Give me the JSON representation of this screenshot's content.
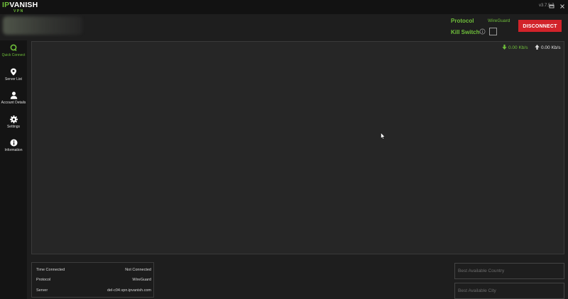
{
  "titlebar": {
    "logo_ip": "IP",
    "logo_vanish": "VANISH",
    "logo_sub": "VPN",
    "version": "v3.7.5.7",
    "minimize_icon": "minimize-icon",
    "close_icon": "close-icon"
  },
  "header": {
    "protocol_label": "Protocol",
    "protocol_value": "WireGuard",
    "kill_switch_label": "Kill Switch",
    "kill_switch_checked": false,
    "disconnect_label": "DISCONNECT"
  },
  "sidebar": {
    "items": [
      {
        "label": "Quick Connect",
        "icon": "quick-connect-icon",
        "active": true
      },
      {
        "label": "Server List",
        "icon": "location-pin-icon",
        "active": false
      },
      {
        "label": "Account Details",
        "icon": "user-icon",
        "active": false
      },
      {
        "label": "Settings",
        "icon": "gear-icon",
        "active": false
      },
      {
        "label": "Information",
        "icon": "info-icon",
        "active": false
      }
    ]
  },
  "speeds": {
    "download": "0.00 Kb/s",
    "upload": "0.00 Kb/s"
  },
  "connection_info": {
    "rows": [
      {
        "key": "Time Connected",
        "value": "Not Connected"
      },
      {
        "key": "Protocol",
        "value": "WireGuard"
      },
      {
        "key": "Server",
        "value": "del-c04.vpn.ipvanish.com"
      }
    ]
  },
  "best": {
    "country_placeholder": "Best Available Country",
    "city_placeholder": "Best Available City"
  },
  "colors": {
    "accent_green": "#6fbf3a",
    "disconnect_red": "#d2232a",
    "background": "#1e1e1e",
    "panel": "#262626",
    "sidebar": "#141414"
  }
}
